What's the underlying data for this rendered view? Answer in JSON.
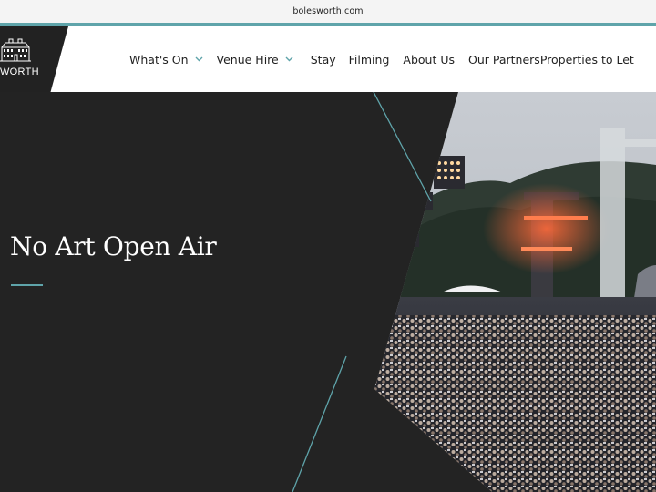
{
  "browser": {
    "url": "bolesworth.com"
  },
  "logo": {
    "text": "WORTH",
    "name": "Bolesworth logo"
  },
  "nav": {
    "items": [
      {
        "label": "What's On",
        "has_dropdown": true
      },
      {
        "label": "Venue Hire",
        "has_dropdown": true
      },
      {
        "label": "Stay",
        "has_dropdown": false
      },
      {
        "label": "Filming",
        "has_dropdown": false
      },
      {
        "label": "About Us",
        "has_dropdown": false
      },
      {
        "label": "Our Partners",
        "has_dropdown": false
      },
      {
        "label": "Properties to Let",
        "has_dropdown": false
      }
    ]
  },
  "hero": {
    "title": "No Art Open Air",
    "image": "festival-crowd-stage-photo"
  },
  "colors": {
    "accent": "#5fa4aa",
    "dark": "#232323",
    "header_bg": "#ffffff"
  }
}
